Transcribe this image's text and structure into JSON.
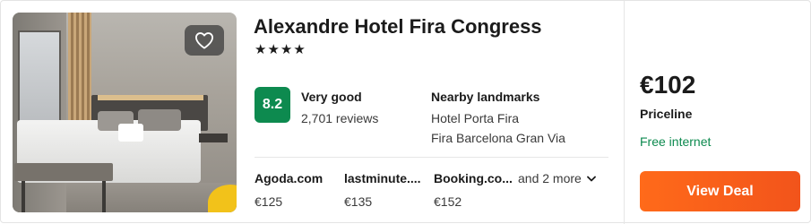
{
  "hotel": {
    "name": "Alexandre Hotel Fira Congress",
    "stars": "★★★★",
    "star_count": 4
  },
  "rating": {
    "score": "8.2",
    "label": "Very good",
    "reviews": "2,701 reviews"
  },
  "landmarks": {
    "title": "Nearby landmarks",
    "items": [
      "Hotel Porta Fira",
      "Fira Barcelona Gran Via"
    ]
  },
  "providers": [
    {
      "name": "Agoda.com",
      "price": "€125"
    },
    {
      "name": "lastminute....",
      "price": "€135"
    },
    {
      "name": "Booking.co...",
      "price": "€152"
    }
  ],
  "more_providers": "and 2 more",
  "deal": {
    "price": "€102",
    "provider": "Priceline",
    "amenity": "Free internet",
    "button_label": "View Deal"
  },
  "icons": {
    "favorite": "heart-icon",
    "more": "chevron-down-icon"
  },
  "colors": {
    "rating_badge": "#0d8a4f",
    "amenity_text": "#0d8a4f",
    "cta": "#ff6a1a"
  }
}
